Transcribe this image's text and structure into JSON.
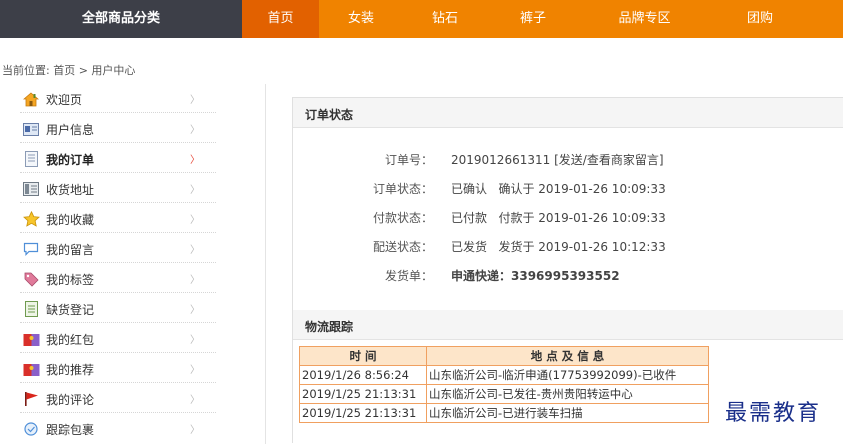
{
  "topnav": {
    "all_categories": "全部商品分类",
    "items": [
      {
        "label": "首页",
        "active": true
      },
      {
        "label": "女装",
        "active": false
      },
      {
        "label": "钻石",
        "active": false
      },
      {
        "label": "裤子",
        "active": false
      },
      {
        "label": "品牌专区",
        "active": false
      },
      {
        "label": "团购",
        "active": false
      }
    ]
  },
  "breadcrumb": "当前位置: 首页 > 用户中心",
  "sidebar": {
    "items": [
      {
        "label": "欢迎页",
        "icon": "house-icon"
      },
      {
        "label": "用户信息",
        "icon": "id-card-icon"
      },
      {
        "label": "我的订单",
        "icon": "document-icon",
        "active": true
      },
      {
        "label": "收货地址",
        "icon": "address-book-icon"
      },
      {
        "label": "我的收藏",
        "icon": "star-icon"
      },
      {
        "label": "我的留言",
        "icon": "speech-bubble-icon"
      },
      {
        "label": "我的标签",
        "icon": "tag-icon"
      },
      {
        "label": "缺货登记",
        "icon": "notepad-icon"
      },
      {
        "label": "我的红包",
        "icon": "red-envelope-icon"
      },
      {
        "label": "我的推荐",
        "icon": "recommend-icon"
      },
      {
        "label": "我的评论",
        "icon": "flag-icon"
      },
      {
        "label": "跟踪包裹",
        "icon": "package-icon"
      }
    ]
  },
  "order_status": {
    "title": "订单状态",
    "order_no_label": "订单号：",
    "order_no_value": "2019012661311",
    "order_no_link": "[发送/查看商家留言]",
    "status_label": "订单状态：",
    "status_value": "已确认   确认于 2019-01-26 10:09:33",
    "pay_label": "付款状态：",
    "pay_value": "已付款   付款于 2019-01-26 10:09:33",
    "ship_label": "配送状态：",
    "ship_value": "已发货   发货于 2019-01-26 10:12:33",
    "invoice_label": "发货单：",
    "invoice_value": "申通快递：3396995393552"
  },
  "logistics": {
    "title": "物流跟踪",
    "headers": [
      "时 间",
      "地 点 及 信 息"
    ],
    "rows": [
      {
        "time": "2019/1/26 8:56:24",
        "info": "山东临沂公司-临沂申通(17753992099)-已收件"
      },
      {
        "time": "2019/1/25 21:13:31",
        "info": "山东临沂公司-已发往-贵州贵阳转运中心"
      },
      {
        "time": "2019/1/25 21:13:31",
        "info": "山东临沂公司-已进行装车扫描"
      }
    ]
  },
  "watermark": "最需教育"
}
